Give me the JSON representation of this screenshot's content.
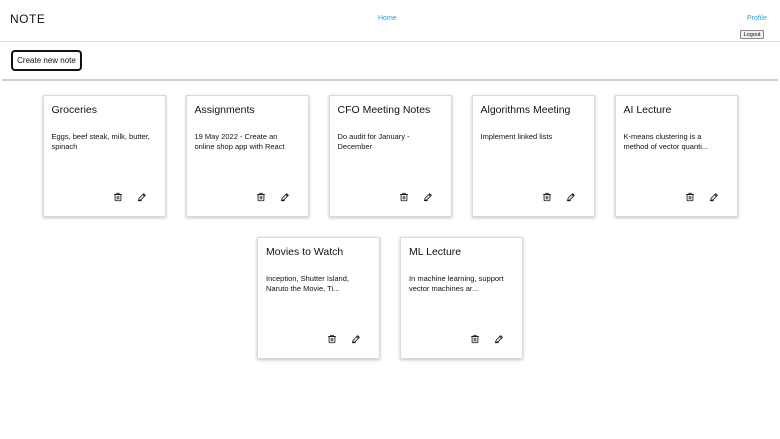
{
  "header": {
    "brand": "NOTE",
    "nav_home": "Home",
    "nav_profile": "Profile",
    "logout_label": "Logout"
  },
  "toolbar": {
    "create_label": "Create new note"
  },
  "colors": {
    "link": "#29a3d6"
  },
  "icons": {
    "delete": "trash-icon",
    "edit": "pencil-icon"
  },
  "notes": [
    {
      "title": "Groceries",
      "preview": "Eggs, beef steak, milk, butter, spinach"
    },
    {
      "title": "Assignments",
      "preview": "19 May 2022 - Create an online shop app with React"
    },
    {
      "title": "CFO Meeting Notes",
      "preview": "Do audit for January - December"
    },
    {
      "title": "Algorithms Meeting",
      "preview": "Implement linked lists"
    },
    {
      "title": "AI Lecture",
      "preview": "K-means clustering is a method of vector quanti..."
    },
    {
      "title": "Movies to Watch",
      "preview": "Inception, Shutter Island, Naruto the Movie, Ti..."
    },
    {
      "title": "ML Lecture",
      "preview": "In machine learning, support vector machines ar..."
    }
  ]
}
